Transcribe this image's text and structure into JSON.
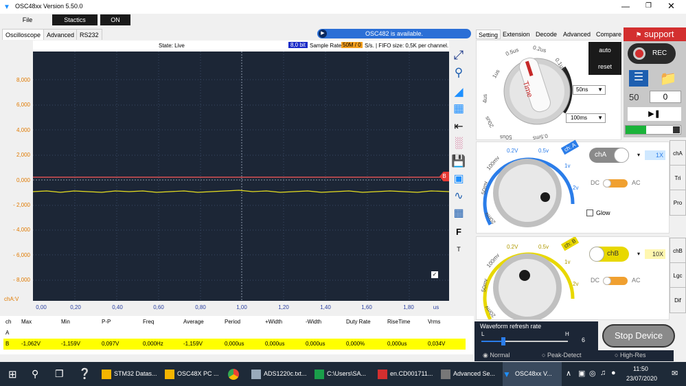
{
  "window": {
    "title": "OSC48xx  Version 5.50.0",
    "accent": "#1e90ff"
  },
  "menu": {
    "file": "File",
    "statics": "Stactics",
    "on": "ON"
  },
  "tabs": {
    "oscilloscope": "Oscilloscope",
    "advanced": "Advanced",
    "rs232": "RS232"
  },
  "notice": "OSC482  is available.",
  "status": {
    "state": "State: Live",
    "bits": "8,0 bit",
    "sample_prefix": "Sample Rate",
    "sample_value": "50M / 0",
    "sample_suffix": "S/s. | FIFO size: 0,5K per channel."
  },
  "y_ticks": [
    "8,000",
    "6,000",
    "4,000",
    "2,000",
    "0,000",
    "- 2,000",
    "- 4,000",
    "- 6,000",
    "- 8,000"
  ],
  "y_unit": "chA:V",
  "x_ticks": [
    "0,00",
    "0,20",
    "0,40",
    "0,60",
    "0,80",
    "1,00",
    "1,20",
    "1,40",
    "1,60",
    "1,80"
  ],
  "x_unit": "us",
  "markers": {
    "b": "B",
    "f": "F",
    "t": "T"
  },
  "measure": {
    "headers": [
      "ch",
      "Max",
      "Min",
      "P-P",
      "Freq",
      "Average",
      "Period",
      "+Width",
      "-Width",
      "Duty Rate",
      "RiseTime",
      "Vrms"
    ],
    "row_a": [
      "A"
    ],
    "row_b": [
      "B",
      "-1,062V",
      "-1,159V",
      "0,097V",
      "0,000Hz",
      "-1,159V",
      "0,000us",
      "0,000us",
      "0,000us",
      "0,000%",
      "0,000us",
      "0,034V"
    ]
  },
  "right_tabs": [
    "Setting",
    "Extension",
    "Decode",
    "Advanced",
    "Compare"
  ],
  "support": "support",
  "time_knob": {
    "labels": [
      "1us",
      "0.5us",
      "0.2us",
      "0.1us",
      "4us",
      "20us",
      "50us",
      "0.5ms",
      "0.5ns"
    ],
    "center": "Time"
  },
  "trigger": {
    "auto": "auto",
    "reset": "reset",
    "time_sel": "50ns",
    "time_sel2": "100ms"
  },
  "rec": {
    "label": "REC",
    "count": "50",
    "value": "0"
  },
  "cha": {
    "badge": "ch: A",
    "toggle": "chA",
    "probe": "1X",
    "dc": "DC",
    "ac": "AC",
    "glow": "Glow",
    "labels": [
      "0.2V",
      "0.5v",
      "1v",
      "2v",
      "100mv",
      "50mv",
      "20mv"
    ]
  },
  "chb": {
    "badge": "ch: B",
    "toggle": "chB",
    "probe": "10X",
    "dc": "DC",
    "ac": "AC",
    "labels": [
      "0.2V",
      "0.5v",
      "1v",
      "2v",
      "100mv",
      "50mv",
      "20mv"
    ]
  },
  "side": {
    "cha": "chA",
    "tri": "Tri",
    "pro": "Pro",
    "chb": "chB",
    "lgc": "Lgc",
    "dif": "Dif"
  },
  "refresh": {
    "title": "Waveform refresh rate",
    "l": "L",
    "h": "H",
    "value": "6",
    "level": 0.25
  },
  "stop": "Stop Device",
  "modes": [
    "Normal",
    "Peak-Detect",
    "High-Res"
  ],
  "taskbar": {
    "items": [
      "STM32 Datas...",
      "OSC48X PC ...",
      "ADS1220c.txt...",
      "C:\\Users\\SA...",
      "en.CD001711...",
      "Advanced Se...",
      "OSC48xx  V..."
    ],
    "time": "11:50",
    "date": "23/07/2020"
  }
}
